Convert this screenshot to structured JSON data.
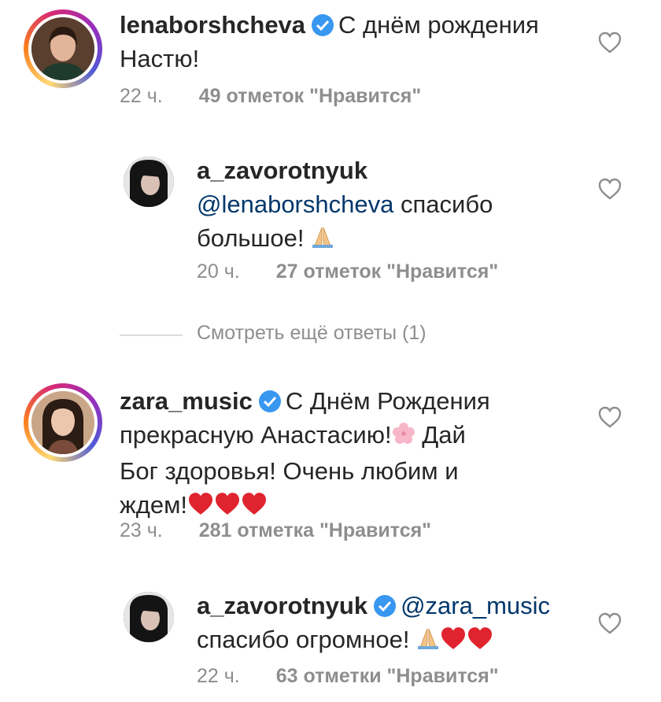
{
  "comments": [
    {
      "username": "lenaborshcheva",
      "text": "С днём рождения Настю!",
      "time": "22 ч.",
      "likes": "49 отметок \"Нравится\""
    },
    {
      "username": "a_zavorotnyuk",
      "mention": "@lenaborshcheva",
      "text_line1": " спасибо",
      "text_line2": "большое!",
      "time": "20 ч.",
      "likes": "27 отметок \"Нравится\""
    },
    {
      "username": "zara_music",
      "text_line1": "С Днём Рождения",
      "text_line2": "прекрасную Анастасию!",
      "text_line2b": " Дай",
      "text_line3": "Бог здоровья! Очень любим и",
      "text_line4": "ждем!",
      "time": "23 ч.",
      "likes": "281 отметка \"Нравится\""
    },
    {
      "username": "a_zavorotnyuk",
      "mention": "@zara_music",
      "text_line2": "спасибо огромное!",
      "time": "22 ч.",
      "likes": "63 отметки \"Нравится\""
    }
  ],
  "view_more_replies": "Смотреть ещё ответы (1)",
  "colors": {
    "text": "#262626",
    "meta": "#8e8e8e",
    "mention": "#00376b",
    "verified": "#3897f0",
    "heart_emoji": "#e0242f"
  }
}
